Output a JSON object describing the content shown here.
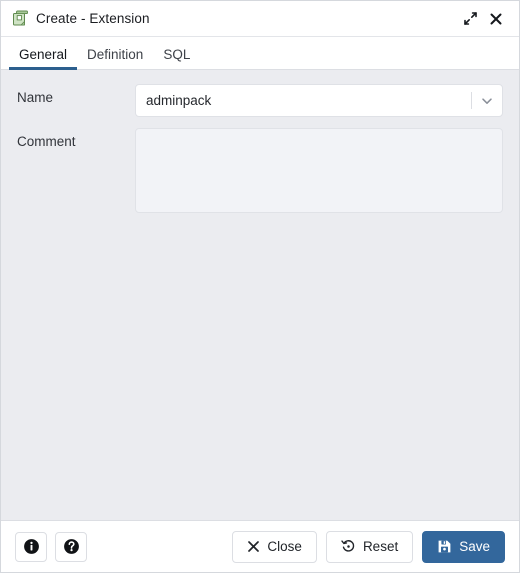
{
  "window": {
    "title": "Create - Extension",
    "icon": "extension-icon",
    "expand_icon": "expand-diagonal-icon",
    "close_icon": "close-x-icon"
  },
  "tabs": [
    {
      "label": "General",
      "active": true
    },
    {
      "label": "Definition",
      "active": false
    },
    {
      "label": "SQL",
      "active": false
    }
  ],
  "form": {
    "name": {
      "label": "Name",
      "value": "adminpack",
      "placeholder": "",
      "dropdown_icon": "chevron-down-icon"
    },
    "comment": {
      "label": "Comment",
      "value": "",
      "placeholder": ""
    }
  },
  "footer": {
    "info_icon": "info-circle-icon",
    "help_icon": "help-circle-icon",
    "close": {
      "label": "Close",
      "icon": "close-x-icon"
    },
    "reset": {
      "label": "Reset",
      "icon": "reset-circular-arrow-icon"
    },
    "save": {
      "label": "Save",
      "icon": "save-floppy-icon"
    }
  },
  "colors": {
    "accent": "#33679c",
    "tab_underline": "#2c5f8e",
    "body_background": "#ebecf0",
    "panel_background": "#ffffff",
    "textarea_background": "#f2f3f7",
    "icon_green": "#8cb87a"
  }
}
